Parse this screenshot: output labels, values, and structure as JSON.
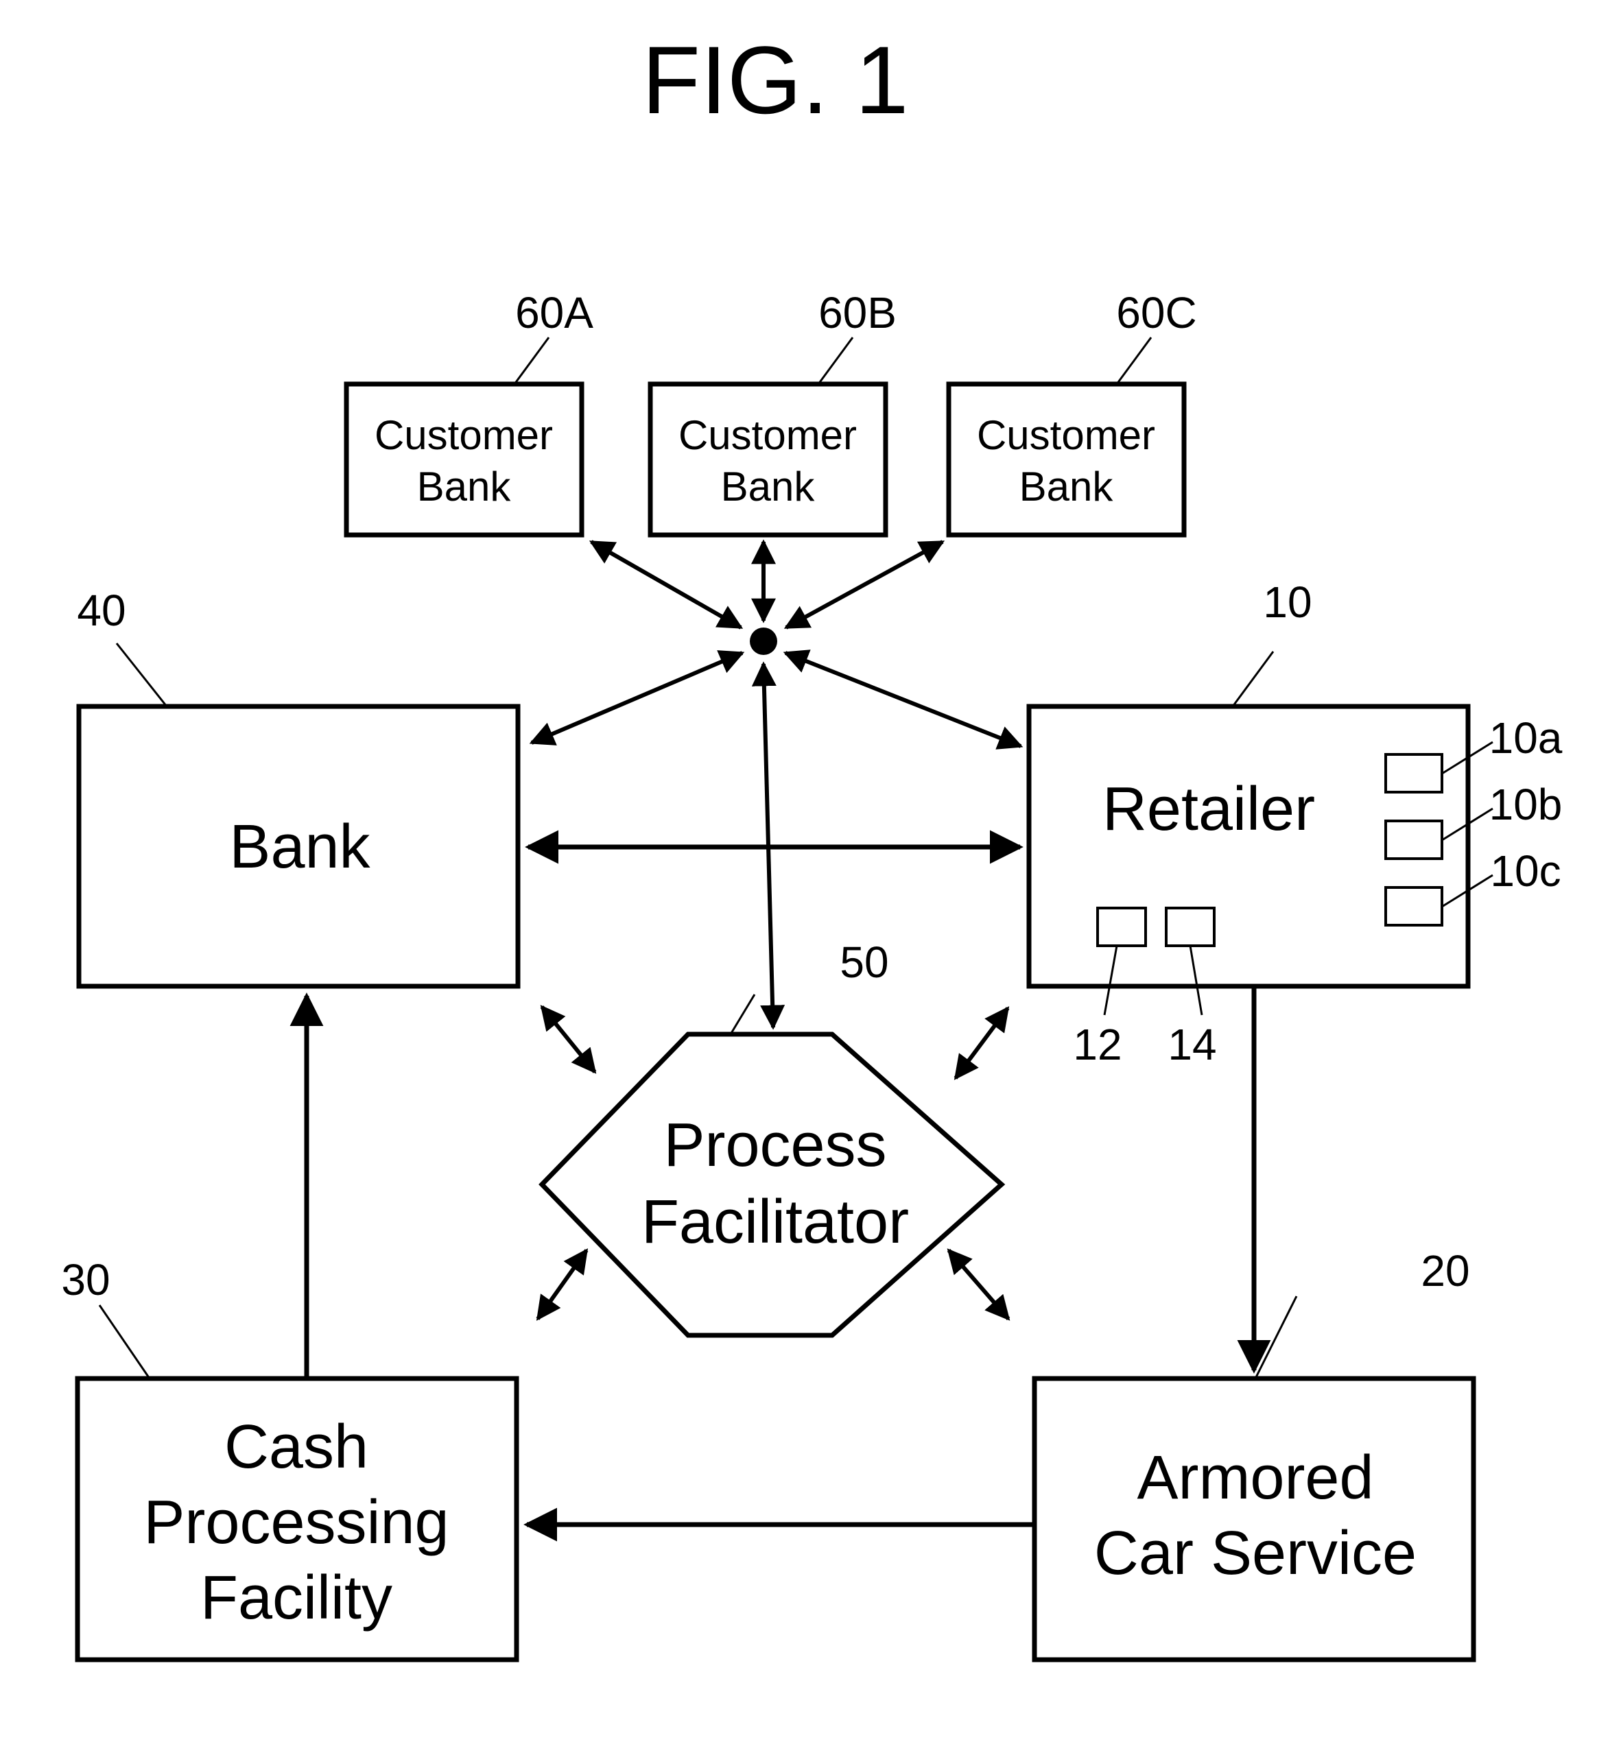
{
  "figure": {
    "title": "FIG. 1"
  },
  "nodes": {
    "customer_bank_a": {
      "ref": "60A",
      "line1": "Customer",
      "line2": "Bank"
    },
    "customer_bank_b": {
      "ref": "60B",
      "line1": "Customer",
      "line2": "Bank"
    },
    "customer_bank_c": {
      "ref": "60C",
      "line1": "Customer",
      "line2": "Bank"
    },
    "bank": {
      "ref": "40",
      "label": "Bank"
    },
    "retailer": {
      "ref": "10",
      "label": "Retailer",
      "sub_refs": [
        "10a",
        "10b",
        "10c"
      ],
      "bottom_refs": [
        "12",
        "14"
      ]
    },
    "process_facilitator": {
      "ref": "50",
      "line1": "Process",
      "line2": "Facilitator"
    },
    "cash_processing": {
      "ref": "30",
      "line1": "Cash",
      "line2": "Processing",
      "line3": "Facility"
    },
    "armored_car": {
      "ref": "20",
      "line1": "Armored",
      "line2": "Car Service"
    }
  },
  "edges": [
    {
      "from": "hub",
      "to": "customer_bank_a",
      "direction": "both"
    },
    {
      "from": "hub",
      "to": "customer_bank_b",
      "direction": "both"
    },
    {
      "from": "hub",
      "to": "customer_bank_c",
      "direction": "both"
    },
    {
      "from": "hub",
      "to": "bank",
      "direction": "both"
    },
    {
      "from": "hub",
      "to": "retailer",
      "direction": "both"
    },
    {
      "from": "hub",
      "to": "process_facilitator",
      "direction": "both"
    },
    {
      "from": "bank",
      "to": "retailer",
      "direction": "both"
    },
    {
      "from": "process_facilitator",
      "to": "bank",
      "direction": "both"
    },
    {
      "from": "process_facilitator",
      "to": "retailer",
      "direction": "both"
    },
    {
      "from": "process_facilitator",
      "to": "cash_processing",
      "direction": "both"
    },
    {
      "from": "process_facilitator",
      "to": "armored_car",
      "direction": "both"
    },
    {
      "from": "retailer",
      "to": "armored_car",
      "direction": "forward"
    },
    {
      "from": "armored_car",
      "to": "cash_processing",
      "direction": "forward"
    },
    {
      "from": "cash_processing",
      "to": "bank",
      "direction": "forward"
    }
  ]
}
